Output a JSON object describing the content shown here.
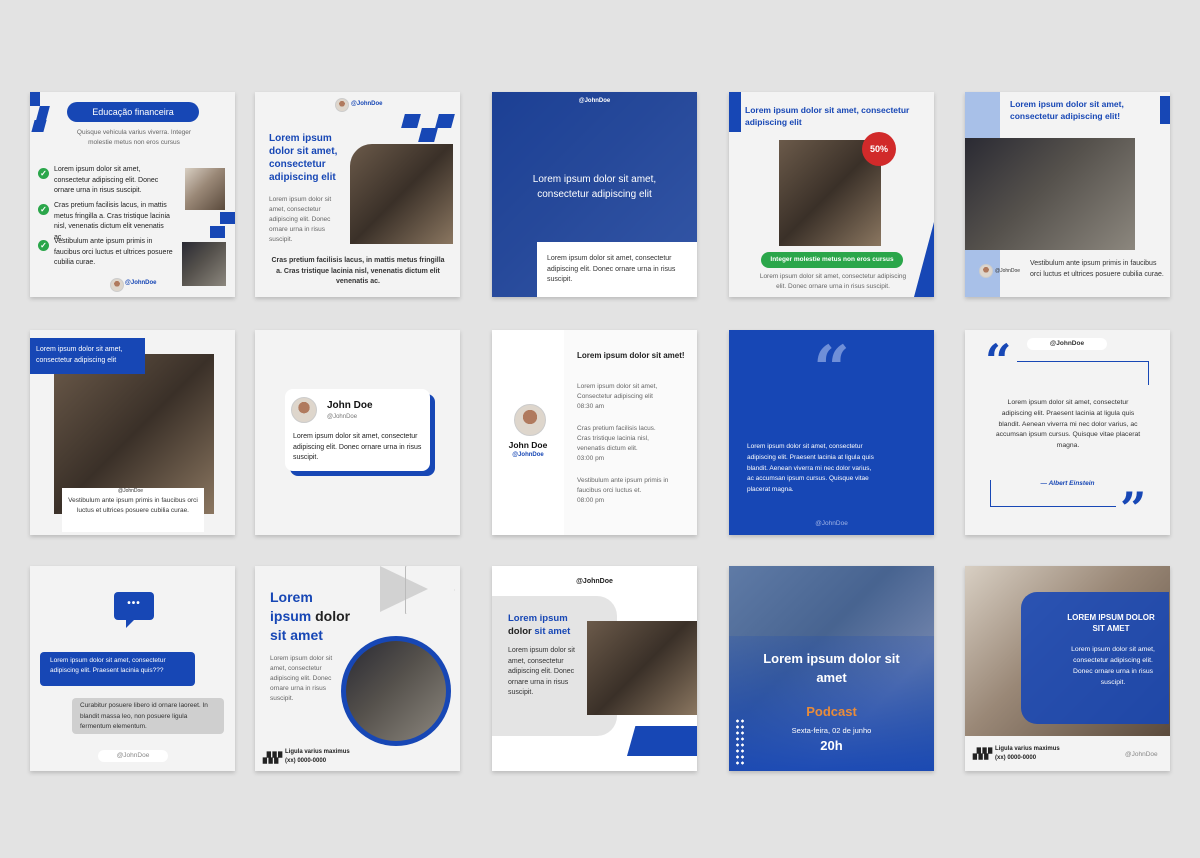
{
  "c1": {
    "pill": "Educação financeira",
    "sub": "Quisque vehicula varius viverra. Integer molestie metus non eros cursus",
    "items": [
      "Lorem ipsum dolor sit amet, consectetur adipiscing elit. Donec ornare urna in risus suscipit.",
      "Cras pretium facilisis lacus, in mattis metus fringilla a. Cras tristique lacinia nisl, venenatis dictum elit venenatis ac.",
      "Vestibulum ante ipsum primis in faucibus orci luctus et ultrices posuere cubilia curae."
    ],
    "handle": "@JohnDoe"
  },
  "c2": {
    "handle": "@JohnDoe",
    "title": "Lorem ipsum dolor sit amet, consectetur adipiscing elit",
    "small": "Lorem ipsum dolor sit amet, consectetur adipiscing elit. Donec ornare urna in risus suscipit.",
    "bottom": "Cras pretium facilisis lacus, in mattis metus fringilla a. Cras tristique lacinia nisl, venenatis dictum elit venenatis ac."
  },
  "c3": {
    "handle": "@JohnDoe",
    "title": "Lorem ipsum dolor sit amet, consectetur adipiscing elit",
    "body": "Lorem ipsum dolor sit amet, consectetur adipiscing elit. Donec ornare urna in risus suscipit."
  },
  "c4": {
    "title": "Lorem ipsum dolor sit amet, consectetur adipiscing elit",
    "badge": "50%",
    "button": "Integer molestie metus non eros cursus",
    "body": "Lorem ipsum dolor sit amet, consectetur adipiscing elit. Donec ornare urna in risus suscipit."
  },
  "c5": {
    "title": "Lorem ipsum dolor sit amet, consectetur adipiscing elit!",
    "handle": "@JohnDoe",
    "body": "Vestibulum ante ipsum primis in faucibus orci luctus et ultrices posuere cubilia curae."
  },
  "c6": {
    "title": "Lorem ipsum dolor sit amet, consectetur adipiscing elit",
    "handle": "@JohnDoe",
    "body": "Vestibulum ante ipsum primis in faucibus orci luctus et ultrices posuere cubilia curae."
  },
  "c7": {
    "name": "John Doe",
    "handle": "@JohnDoe",
    "body": "Lorem ipsum dolor sit amet, consectetur adipiscing elit. Donec ornare urna in risus suscipit."
  },
  "c8": {
    "name": "John Doe",
    "handle": "@JohnDoe",
    "title": "Lorem ipsum dolor sit amet!",
    "entries": [
      {
        "text": "Lorem ipsum dolor sit amet, Consectetur adipiscing elit",
        "time": "08:30 am"
      },
      {
        "text": "Cras pretium facilisis lacus. Cras tristique lacinia nisl, venenatis dictum elit.",
        "time": "03:00 pm"
      },
      {
        "text": "Vestibulum ante ipsum primis in faucibus orci luctus et.",
        "time": "08:00 pm"
      }
    ]
  },
  "c9": {
    "quote_mark": "“",
    "body": "Lorem ipsum dolor sit amet, consectetur adipiscing elit. Praesent lacinia at ligula quis blandit. Aenean viverra mi nec dolor varius, ac accumsan ipsum cursus. Quisque vitae placerat magna.",
    "handle": "@JohnDoe"
  },
  "c10": {
    "handle": "@JohnDoe",
    "open_quote": "“",
    "close_quote": "”",
    "body": "Lorem ipsum dolor sit amet, consectetur adipiscing elit. Praesent lacinia at ligula quis blandit. Aenean viverra mi nec dolor varius, ac accumsan ipsum cursus. Quisque vitae placerat magna.",
    "author": "— Albert Einstein"
  },
  "c11": {
    "bubble_icon": "•••",
    "msg1": "Lorem ipsum dolor sit amet, consectetur adipiscing elit. Praesent lacinia quis???",
    "msg2": "Curabitur posuere libero id ornare laoreet. In blandit massa leo, non posuere ligula fermentum elementum.",
    "handle": "@JohnDoe"
  },
  "c12": {
    "title_a": "Lorem",
    "title_b": "ipsum",
    "title_c": "dolor",
    "title_d": "sit amet",
    "body": "Lorem ipsum dolor sit amet, consectetur adipiscing elit. Donec ornare urna in risus suscipit.",
    "footer1": "Ligula varius maximus",
    "footer2": "(xx) 0000-0000"
  },
  "c13": {
    "handle": "@JohnDoe",
    "title_a": "Lorem ipsum",
    "title_b": "dolor",
    "title_c": "sit amet",
    "body": "Lorem ipsum dolor sit amet, consectetur adipiscing elit. Donec ornare urna in risus suscipit."
  },
  "c14": {
    "title": "Lorem ipsum dolor sit amet",
    "podcast": "Podcast",
    "date": "Sexta-feira, 02 de junho",
    "time": "20h"
  },
  "c15": {
    "title": "LOREM IPSUM DOLOR SIT AMET",
    "body": "Lorem ipsum dolor sit amet, consectetur adipiscing elit. Donec ornare urna in risus suscipit.",
    "footer1": "Ligula varius maximus",
    "footer2": "(xx) 0000-0000",
    "handle": "@JohnDoe"
  },
  "colors": {
    "brand_blue": "#1747b5",
    "green": "#2aa64a",
    "orange": "#e98c3a",
    "red_badge": "#d12a2a"
  }
}
